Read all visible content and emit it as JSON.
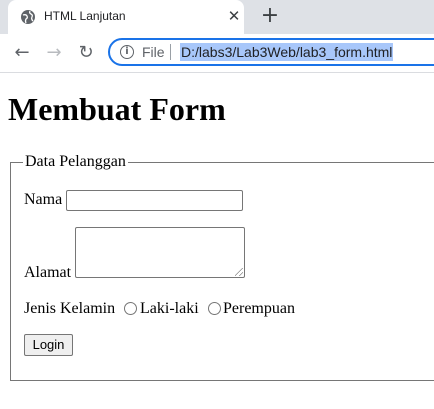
{
  "browser": {
    "tab_title": "HTML Lanjutan",
    "close_glyph": "✕",
    "new_tab_glyph": "+",
    "nav": {
      "back_glyph": "←",
      "forward_glyph": "→",
      "reload_glyph": "↻"
    },
    "address": {
      "info_glyph": "i",
      "scheme_label": "File",
      "url": "D:/labs3/Lab3Web/lab3_form.html"
    }
  },
  "page": {
    "heading": "Membuat Form",
    "fieldset": {
      "legend": "Data Pelanggan",
      "nama_label": "Nama",
      "nama_value": "",
      "alamat_label": "Alamat",
      "alamat_value": "",
      "gender_label": "Jenis Kelamin",
      "gender_options": [
        "Laki-laki",
        "Perempuan"
      ],
      "login_button": "Login"
    }
  },
  "colors": {
    "tabbar_bg": "#dee1e6",
    "omnibox_border": "#1a73e8",
    "url_highlight": "#a8c7fa"
  }
}
